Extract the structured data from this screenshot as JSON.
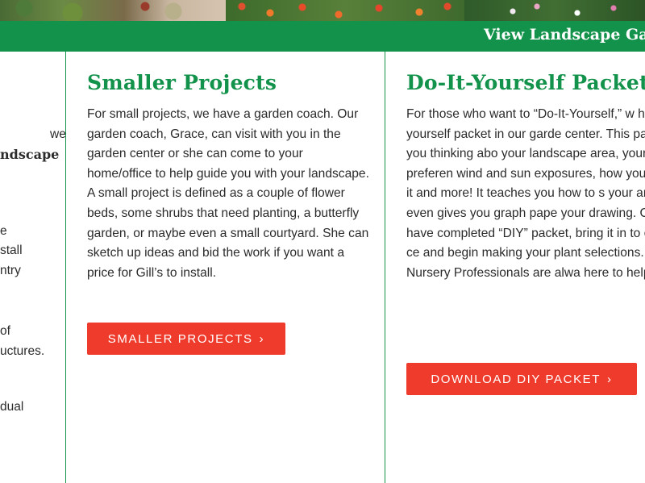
{
  "banner": {
    "link_text": "View Landscape Ga"
  },
  "left_column_fragments": [
    "we",
    "ndscape",
    "e",
    "stall",
    "ntry",
    "of",
    "uctures.",
    "dual"
  ],
  "smaller_projects": {
    "title": "Smaller Projects",
    "body": "For small projects, we have a garden coach. Our garden coach, Grace, can visit with you in the garden center or she can come to your home/office to help guide you with your landscape. A small project is defined as a couple of flower beds, some shrubs that need planting, a butterfly garden, or maybe even a small courtyard. She can sketch up ideas and bid the work if you want a price for Gill’s to install.",
    "button_label": "SMALLER PROJECTS",
    "button_icon": "chevron-right-icon"
  },
  "diy_packet": {
    "title": "Do-It-Yourself Packet",
    "body": "For those who want to “Do-It-Yourself,” w have a do-it-yourself packet in our garde center. This packet gets you thinking abo your landscape area, your style preferen wind and sun exposures, how you are go use it and more! It teaches you how to s your area and even gives you graph pape your drawing. Once you have completed “DIY” packet, bring it in to our garden ce and begin making your plant selections. Certified Nursery Professionals are alwa here to help.",
    "button_label": "DOWNLOAD DIY PACKET",
    "button_icon": "chevron-right-icon"
  },
  "colors": {
    "brand_green": "#12924a",
    "cta_red": "#ef3b2c",
    "text": "#2b2b2b"
  }
}
